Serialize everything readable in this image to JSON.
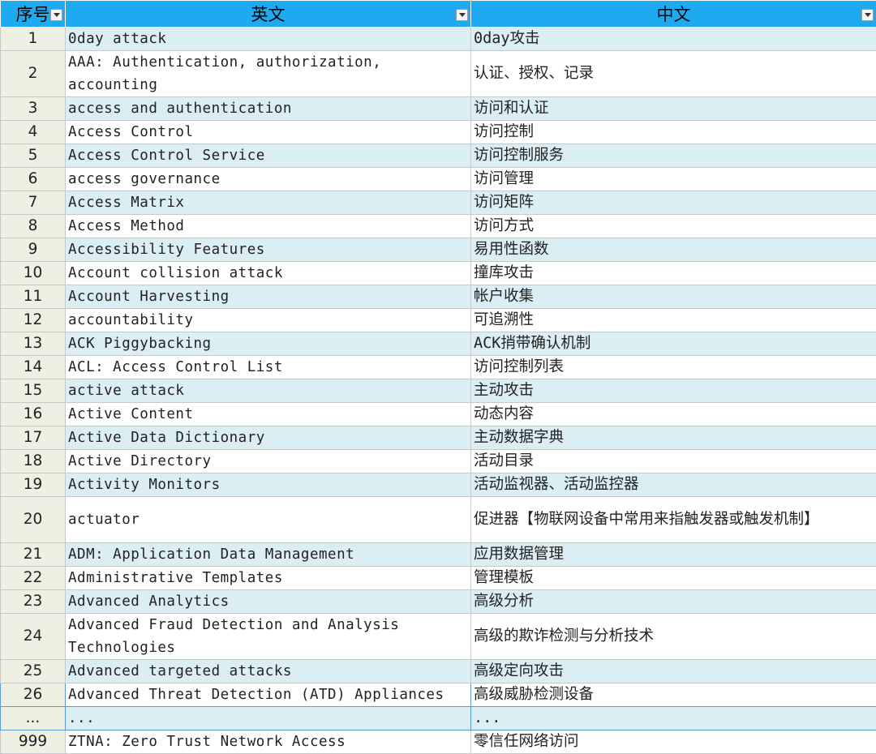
{
  "headers": {
    "num": "序号",
    "en": "英文",
    "zh": "中文"
  },
  "rows": [
    {
      "num": "1",
      "en": "0day attack",
      "zh": "0day攻击"
    },
    {
      "num": "2",
      "en": "AAA: Authentication, authorization, accounting",
      "zh": "认证、授权、记录"
    },
    {
      "num": "3",
      "en": "access and authentication",
      "zh": "访问和认证"
    },
    {
      "num": "4",
      "en": "Access Control",
      "zh": "访问控制"
    },
    {
      "num": "5",
      "en": "Access Control Service",
      "zh": "访问控制服务"
    },
    {
      "num": "6",
      "en": "access governance",
      "zh": "访问管理"
    },
    {
      "num": "7",
      "en": "Access Matrix",
      "zh": "访问矩阵"
    },
    {
      "num": "8",
      "en": "Access Method",
      "zh": "访问方式"
    },
    {
      "num": "9",
      "en": "Accessibility Features",
      "zh": "易用性函数"
    },
    {
      "num": "10",
      "en": "Account collision attack",
      "zh": "撞库攻击"
    },
    {
      "num": "11",
      "en": "Account Harvesting",
      "zh": "帐户收集"
    },
    {
      "num": "12",
      "en": "accountability",
      "zh": "可追溯性"
    },
    {
      "num": "13",
      "en": "ACK Piggybacking",
      "zh": "ACK捎带确认机制"
    },
    {
      "num": "14",
      "en": "ACL: Access Control List",
      "zh": "访问控制列表"
    },
    {
      "num": "15",
      "en": "active attack",
      "zh": "主动攻击"
    },
    {
      "num": "16",
      "en": "Active Content",
      "zh": "动态内容"
    },
    {
      "num": "17",
      "en": "Active Data Dictionary",
      "zh": "主动数据字典"
    },
    {
      "num": "18",
      "en": "Active Directory",
      "zh": "活动目录"
    },
    {
      "num": "19",
      "en": "Activity Monitors",
      "zh": "活动监视器、活动监控器"
    },
    {
      "num": "20",
      "en": "actuator",
      "zh": "促进器【物联网设备中常用来指触发器或触发机制】"
    },
    {
      "num": "21",
      "en": "ADM: Application Data Management",
      "zh": "应用数据管理"
    },
    {
      "num": "22",
      "en": "Administrative Templates",
      "zh": "管理模板"
    },
    {
      "num": "23",
      "en": "Advanced Analytics",
      "zh": "高级分析"
    },
    {
      "num": "24",
      "en": "Advanced Fraud Detection and Analysis Technologies",
      "zh": "高级的欺诈检测与分析技术"
    },
    {
      "num": "25",
      "en": "Advanced targeted attacks",
      "zh": "高级定向攻击"
    },
    {
      "num": "26",
      "en": "Advanced Threat Detection (ATD) Appliances",
      "zh": "高级威胁检测设备"
    },
    {
      "num": "...",
      "en": "...",
      "zh": "..."
    },
    {
      "num": "999",
      "en": "ZTNA: Zero Trust Network Access",
      "zh": "零信任网络访问"
    }
  ]
}
